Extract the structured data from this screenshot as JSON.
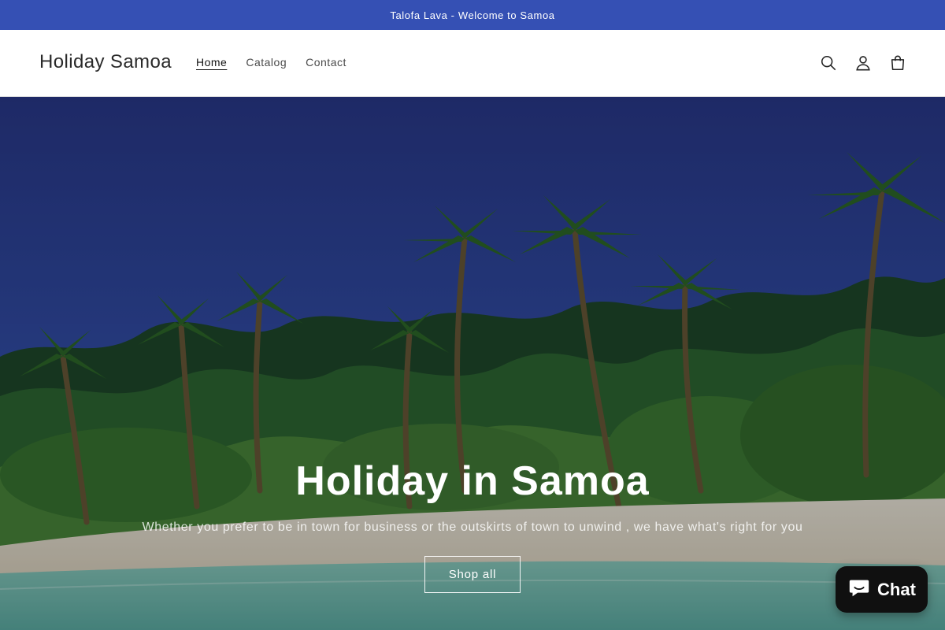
{
  "announcement": {
    "text": "Talofa Lava - Welcome to Samoa"
  },
  "header": {
    "logo": "Holiday Samoa",
    "nav": [
      {
        "label": "Home",
        "active": true
      },
      {
        "label": "Catalog",
        "active": false
      },
      {
        "label": "Contact",
        "active": false
      }
    ],
    "icons": [
      "search-icon",
      "account-icon",
      "cart-icon"
    ]
  },
  "hero": {
    "title": "Holiday in Samoa",
    "subtitle": "Whether you prefer to be in town for business or the outskirts of town to unwind , we have what's right for you",
    "button_label": "Shop all"
  },
  "chat": {
    "label": "Chat",
    "icon": "chat-bubble-icon"
  },
  "colors": {
    "announcement_bg": "#3550b4",
    "chat_bg": "#101010"
  }
}
